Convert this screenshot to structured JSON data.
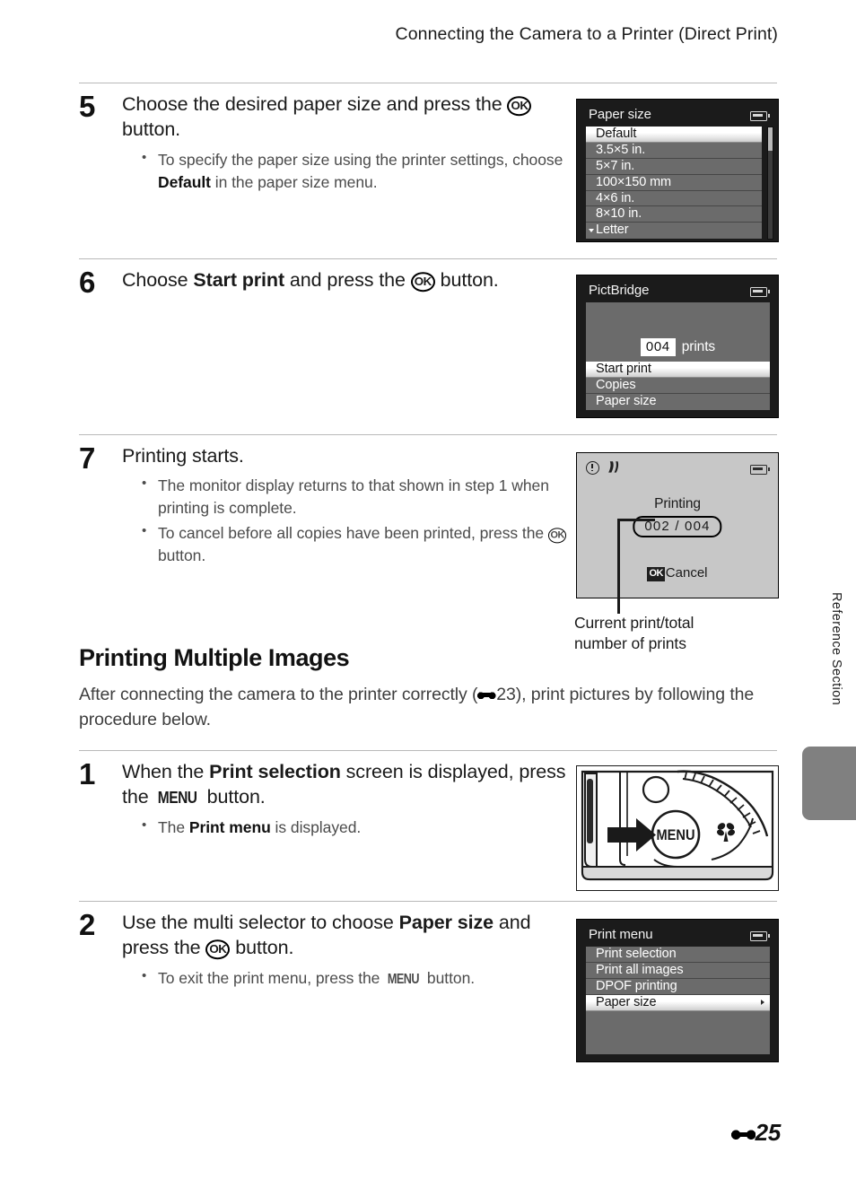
{
  "header": {
    "title": "Connecting the Camera to a Printer (Direct Print)"
  },
  "steps": [
    {
      "number": "5",
      "title_before": "Choose the desired paper size and press the",
      "title_after": "button.",
      "bullets": [
        {
          "pre": "To specify the paper size using the printer settings, choose ",
          "bold": "Default",
          "post": " in the paper size menu."
        }
      ]
    },
    {
      "number": "6",
      "title_pre": "Choose ",
      "title_bold": "Start print",
      "title_mid": " and press the ",
      "title_post": " button."
    },
    {
      "number": "7",
      "title": "Printing starts.",
      "bullets": [
        {
          "pre": "The monitor display returns to that shown in step 1 when printing is complete."
        },
        {
          "pre": "To cancel before all copies have been printed, press the ",
          "post": " button."
        }
      ]
    },
    {
      "number": "1",
      "title_pre": "When the ",
      "title_bold": "Print selection",
      "title_mid": " screen is displayed, press the ",
      "title_post": " button.",
      "bullets": [
        {
          "pre": "The ",
          "bold": "Print menu",
          "post": " is displayed."
        }
      ]
    },
    {
      "number": "2",
      "title_pre": "Use the multi selector to choose ",
      "title_bold": "Paper size",
      "title_mid": " and press the ",
      "title_post": " button.",
      "bullets": [
        {
          "pre": "To exit the print menu, press the ",
          "post": " button."
        }
      ]
    }
  ],
  "section": {
    "heading": "Printing Multiple Images",
    "intro_pre": "After connecting the camera to the printer correctly (",
    "intro_ref": "23",
    "intro_post": "), print pictures by following the procedure below."
  },
  "screens": {
    "paper_size": {
      "title": "Paper size",
      "items": [
        {
          "label": "Default",
          "selected": true
        },
        {
          "label": "3.5×5 in.",
          "selected": false
        },
        {
          "label": "5×7 in.",
          "selected": false
        },
        {
          "label": "100×150 mm",
          "selected": false
        },
        {
          "label": "4×6 in.",
          "selected": false
        },
        {
          "label": "8×10 in.",
          "selected": false
        },
        {
          "label": "Letter",
          "selected": false,
          "more": true
        }
      ]
    },
    "pictbridge": {
      "title": "PictBridge",
      "count": "004",
      "count_label": "prints",
      "items": [
        {
          "label": "Start print",
          "selected": true
        },
        {
          "label": "Copies",
          "selected": false
        },
        {
          "label": "Paper size",
          "selected": false
        }
      ]
    },
    "printing": {
      "status": "Printing",
      "counter": "002 / 004",
      "cancel_ok": "OK",
      "cancel_label": "Cancel",
      "callout": "Current print/total\nnumber of prints",
      "callout_line1": "Current print/total",
      "callout_line2": "number of prints"
    },
    "print_menu": {
      "title": "Print menu",
      "items": [
        {
          "label": "Print selection",
          "selected": false
        },
        {
          "label": "Print all images",
          "selected": false
        },
        {
          "label": "DPOF printing",
          "selected": false
        },
        {
          "label": "Paper size",
          "selected": true,
          "submenu": true
        }
      ]
    }
  },
  "camera_illustration": {
    "menu_button_label": "MENU"
  },
  "sidebar": {
    "section_label": "Reference Section"
  },
  "footer": {
    "page_number": "25"
  },
  "glyphs": {
    "ok": "OK",
    "menu": "MENU"
  }
}
